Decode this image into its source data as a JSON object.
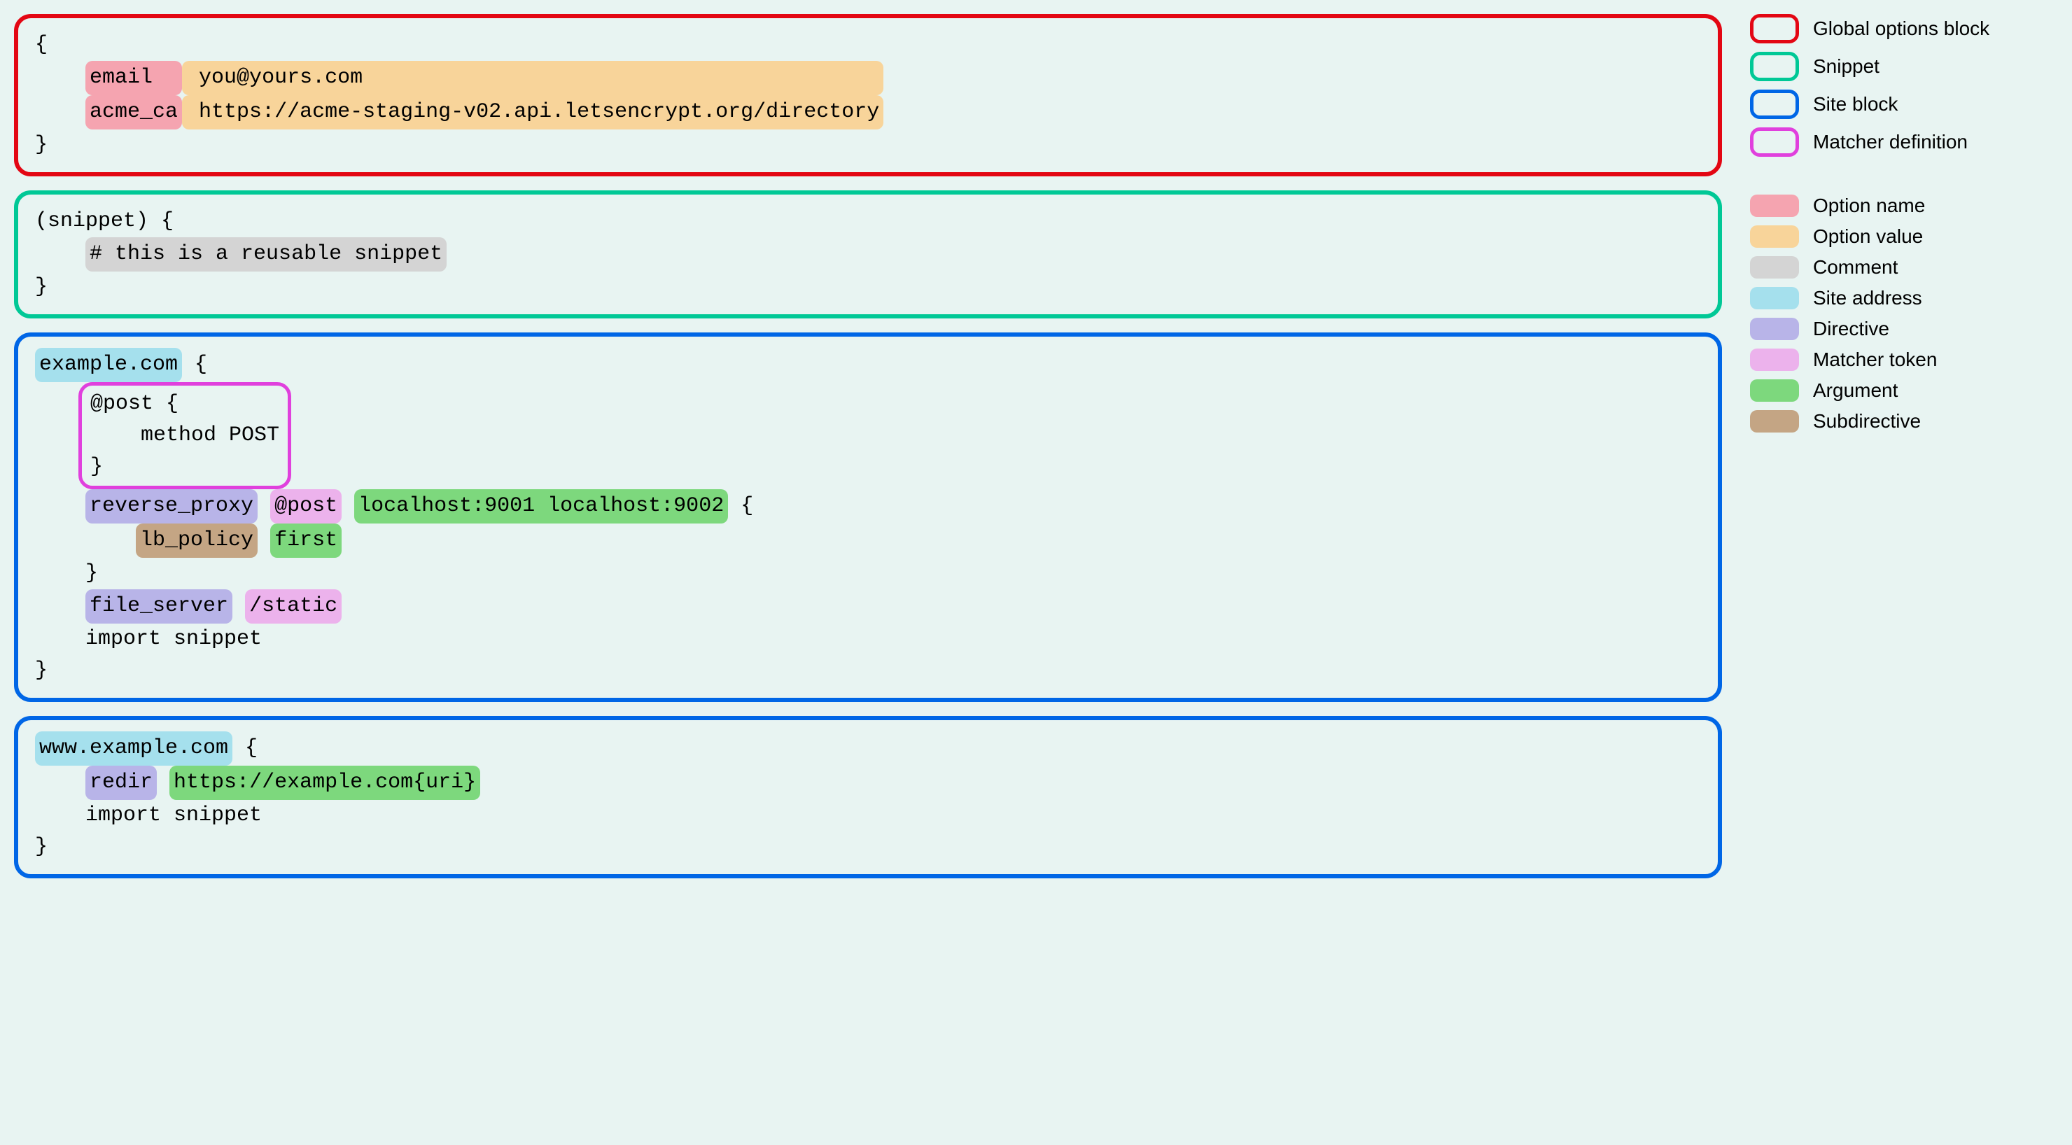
{
  "globalOptions": {
    "open": "{",
    "close": "}",
    "indent": "    ",
    "lines": [
      {
        "name": "email  ",
        "value": " you@yours.com                                         "
      },
      {
        "name": "acme_ca",
        "value": " https://acme-staging-v02.api.letsencrypt.org/directory"
      }
    ]
  },
  "snippet": {
    "open": "(snippet) {",
    "close": "}",
    "indent": "    ",
    "comment": "# this is a reusable snippet"
  },
  "site1": {
    "address": "example.com",
    "open": " {",
    "close": "}",
    "indent": "    ",
    "matcher": {
      "line1": "@post {",
      "line2": "    method POST",
      "line3": "}"
    },
    "reverseProxy": {
      "directive": "reverse_proxy",
      "matcherToken": "@post",
      "args": "localhost:9001 localhost:9002",
      "open": " {",
      "sub": {
        "indent": "        ",
        "name": "lb_policy",
        "arg": "first"
      },
      "close": "    }"
    },
    "fileServer": {
      "directive": "file_server",
      "matcherToken": "/static"
    },
    "import": "    import snippet"
  },
  "site2": {
    "address": "www.example.com",
    "open": " {",
    "close": "}",
    "indent": "    ",
    "redir": {
      "directive": "redir",
      "arg": "https://example.com{uri}"
    },
    "import": "    import snippet"
  },
  "legend": {
    "outlines": [
      {
        "label": "Global options block",
        "color": "lb-red"
      },
      {
        "label": "Snippet",
        "color": "lb-green"
      },
      {
        "label": "Site block",
        "color": "lb-blue"
      },
      {
        "label": "Matcher definition",
        "color": "lb-magenta"
      }
    ],
    "fills": [
      {
        "label": "Option name",
        "class": "hl-option-name"
      },
      {
        "label": "Option value",
        "class": "hl-option-value"
      },
      {
        "label": "Comment",
        "class": "hl-comment"
      },
      {
        "label": "Site address",
        "class": "hl-site-address"
      },
      {
        "label": "Directive",
        "class": "hl-directive"
      },
      {
        "label": "Matcher token",
        "class": "hl-matcher-token"
      },
      {
        "label": "Argument",
        "class": "hl-argument"
      },
      {
        "label": "Subdirective",
        "class": "hl-subdirective"
      }
    ]
  }
}
